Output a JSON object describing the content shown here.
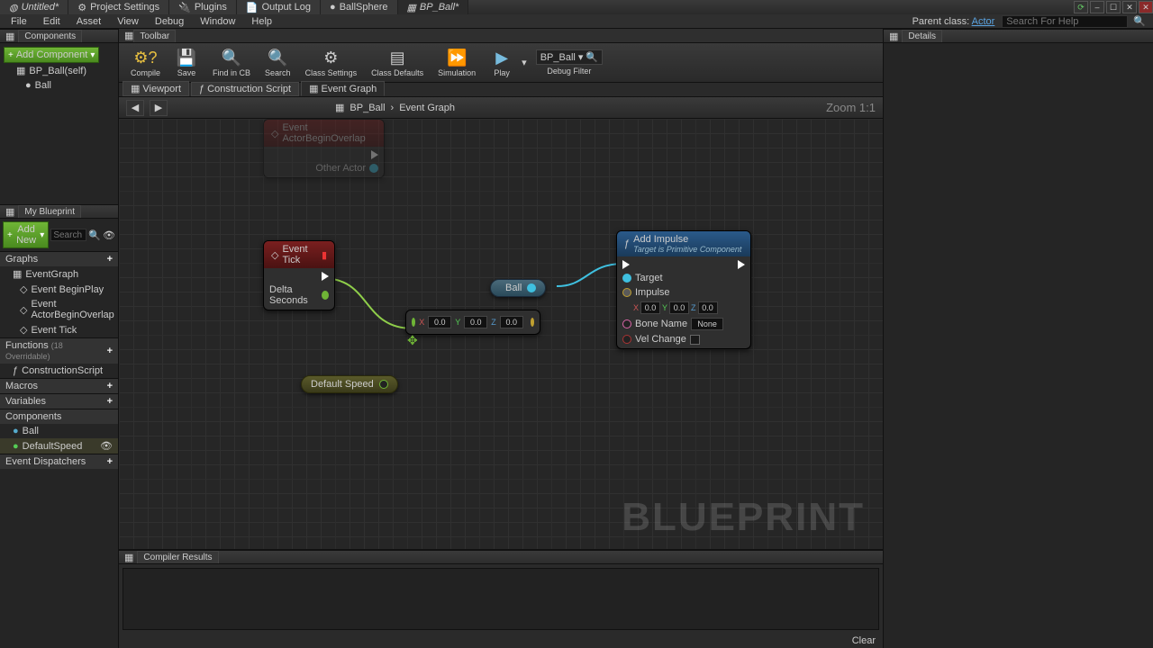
{
  "titlebar": {
    "tabs": [
      "Untitled*",
      "Project Settings",
      "Plugins",
      "Output Log",
      "BallSphere",
      "BP_Ball*"
    ]
  },
  "menubar": {
    "items": [
      "File",
      "Edit",
      "Asset",
      "View",
      "Debug",
      "Window",
      "Help"
    ],
    "parent_class_label": "Parent class:",
    "parent_class": "Actor",
    "search_placeholder": "Search For Help"
  },
  "components_panel": {
    "header": "Components",
    "add_component": "Add Component",
    "items": [
      "BP_Ball(self)",
      "Ball"
    ]
  },
  "my_blueprint": {
    "header": "My Blueprint",
    "add_new": "Add New",
    "search_placeholder": "Search",
    "sections": {
      "graphs": "Graphs",
      "functions": "Functions",
      "functions_note": "(18 Overridable)",
      "macros": "Macros",
      "variables": "Variables",
      "components": "Components",
      "event_dispatchers": "Event Dispatchers"
    },
    "graph_items": [
      "EventGraph",
      "Event BeginPlay",
      "Event ActorBeginOverlap",
      "Event Tick"
    ],
    "function_items": [
      "ConstructionScript"
    ],
    "variable_items": [
      "Ball",
      "DefaultSpeed"
    ]
  },
  "toolbar": {
    "header": "Toolbar",
    "buttons": {
      "compile": "Compile",
      "save": "Save",
      "find_cb": "Find in CB",
      "search": "Search",
      "class_settings": "Class Settings",
      "class_defaults": "Class Defaults",
      "simulation": "Simulation",
      "play": "Play"
    },
    "debug_select": "BP_Ball",
    "debug_filter": "Debug Filter"
  },
  "sub_tabs": {
    "viewport": "Viewport",
    "construction": "Construction Script",
    "event_graph": "Event Graph"
  },
  "graph_header": {
    "breadcrumb_root": "BP_Ball",
    "breadcrumb_leaf": "Event Graph",
    "zoom": "Zoom 1:1"
  },
  "graph": {
    "blueprint_wm": "BLUEPRINT",
    "event_begin_overlap": {
      "title": "Event ActorBeginOverlap",
      "other_actor": "Other Actor"
    },
    "event_tick": {
      "title": "Event Tick",
      "delta": "Delta Seconds"
    },
    "ball_var": "Ball",
    "default_speed_var": "Default Speed",
    "vector_inputs": {
      "x_label": "X",
      "y_label": "Y",
      "z_label": "Z",
      "x": "0.0",
      "y": "0.0",
      "z": "0.0"
    },
    "add_impulse": {
      "title": "Add Impulse",
      "subtitle": "Target is Primitive Component",
      "target": "Target",
      "impulse": "Impulse",
      "impulse_x": "0.0",
      "impulse_y": "0.0",
      "impulse_z": "0.0",
      "bone_name": "Bone Name",
      "bone_val": "None",
      "vel_change": "Vel Change"
    }
  },
  "compiler": {
    "header": "Compiler Results",
    "clear": "Clear"
  },
  "details": {
    "header": "Details"
  }
}
